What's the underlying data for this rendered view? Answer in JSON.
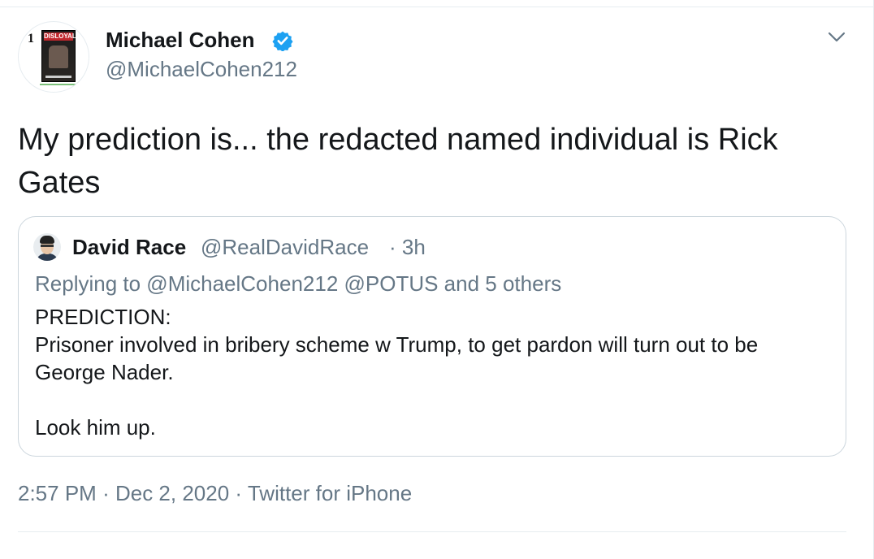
{
  "tweet": {
    "author": {
      "name": "Michael Cohen",
      "handle": "@MichaelCohen212",
      "avatar_rank": "1",
      "avatar_book_title": "DISLOYAL"
    },
    "text": "My prediction is... the redacted named individual is Rick Gates",
    "time": "2:57 PM",
    "date": "Dec 2, 2020",
    "source": "Twitter for iPhone",
    "separator": "·"
  },
  "quoted": {
    "name": "David Race",
    "handle": "@RealDavidRace",
    "age": "· 3h",
    "replying_to": "Replying to @MichaelCohen212 @POTUS and 5 others",
    "body": "PREDICTION:\nPrisoner involved in bribery scheme w Trump, to get pardon will turn out to be George Nader.\n\nLook him up."
  },
  "icons": {
    "verified": "verified-badge-icon",
    "more": "chevron-down-icon"
  },
  "colors": {
    "text": "#14171a",
    "muted": "#657786",
    "verified": "#1da1f2",
    "border": "#ccd6dd"
  }
}
